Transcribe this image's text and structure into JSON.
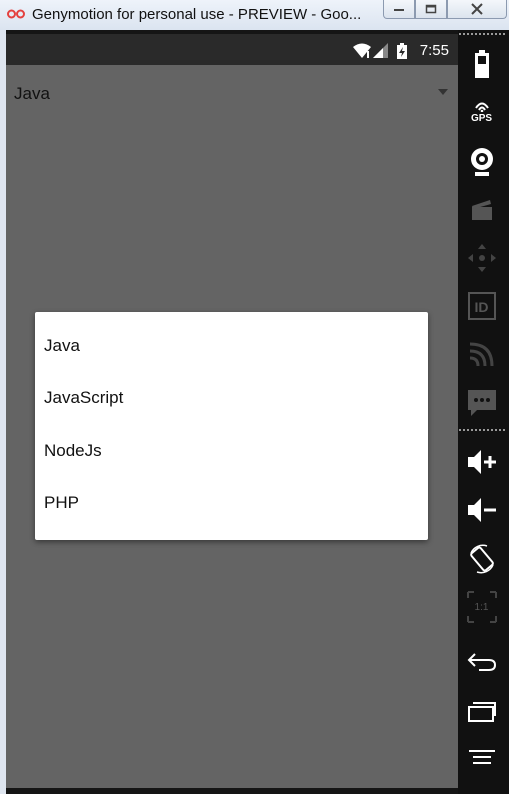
{
  "window": {
    "title": "Genymotion for personal use - PREVIEW - Goo..."
  },
  "status_bar": {
    "time": "7:55"
  },
  "spinner": {
    "selected": "Java"
  },
  "dialog": {
    "options": [
      "Java",
      "JavaScript",
      "NodeJs",
      "PHP"
    ]
  },
  "sidebar": {
    "gps_label": "GPS",
    "id_label": "ID",
    "pixel_perfect_label": "1:1",
    "icons": [
      "battery-icon",
      "gps-icon",
      "camera-icon",
      "capture-icon",
      "dpad-icon",
      "identifiers-icon",
      "cast-icon",
      "sms-icon",
      "volume-up-icon",
      "volume-down-icon",
      "rotate-icon",
      "pixel-perfect-icon",
      "back-icon",
      "recent-apps-icon",
      "menu-icon"
    ]
  },
  "colors": {
    "device_background": "#646464",
    "status_bar": "#2a2a2a",
    "sidebar": "#111111",
    "dialog": "#ffffff"
  }
}
